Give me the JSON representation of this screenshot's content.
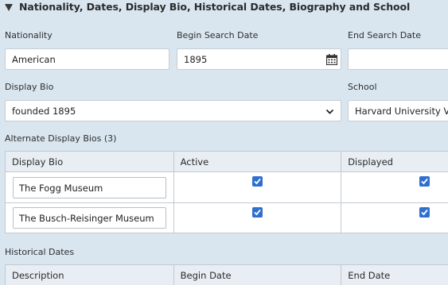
{
  "section": {
    "title": "Nationality, Dates, Display Bio, Historical Dates, Biography and School"
  },
  "nationality": {
    "label": "Nationality",
    "value": "American"
  },
  "begin_search_date": {
    "label": "Begin Search Date",
    "value": "1895"
  },
  "end_search_date": {
    "label": "End Search Date",
    "value": ""
  },
  "display_bio": {
    "label": "Display Bio",
    "value": "founded 1895"
  },
  "school": {
    "label": "School",
    "value": "Harvard University Vis"
  },
  "alternate_bios": {
    "label": "Alternate Display Bios",
    "count": "(3)",
    "columns": [
      "Display Bio",
      "Active",
      "Displayed"
    ],
    "rows": [
      {
        "bio": "The Fogg Museum",
        "active": true,
        "displayed": true
      },
      {
        "bio": "The Busch-Reisinger Museum",
        "active": true,
        "displayed": true
      }
    ]
  },
  "historical_dates": {
    "label": "Historical Dates",
    "columns": [
      "Description",
      "Begin Date",
      "End Date"
    ]
  },
  "colors": {
    "background": "#d9e6f0",
    "checkbox": "#2f6fcf",
    "header_cell": "#e8eef3"
  }
}
